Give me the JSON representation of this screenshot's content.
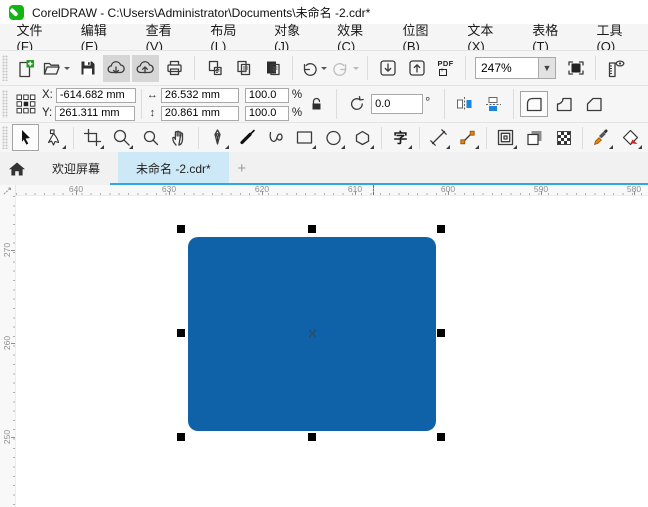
{
  "window": {
    "title": "CorelDRAW - C:\\Users\\Administrator\\Documents\\未命名 -2.cdr*"
  },
  "menu": {
    "items": [
      {
        "label": "文件(F)"
      },
      {
        "label": "编辑(E)"
      },
      {
        "label": "查看(V)"
      },
      {
        "label": "布局(L)"
      },
      {
        "label": "对象(J)"
      },
      {
        "label": "效果(C)"
      },
      {
        "label": "位图(B)"
      },
      {
        "label": "文本(X)"
      },
      {
        "label": "表格(T)"
      },
      {
        "label": "工具(O)"
      }
    ]
  },
  "standard_toolbar": {
    "zoom_level": "247%",
    "pdf_label": "PDF",
    "dropdown_glyph": "▼"
  },
  "property_bar": {
    "x_label": "X:",
    "x_value": "-614.682 mm",
    "y_label": "Y:",
    "y_value": "261.311 mm",
    "width_value": "26.532 mm",
    "height_value": "20.861 mm",
    "width_icon_glyph": "↔",
    "height_icon_glyph": "↕",
    "scale_x_value": "100.0",
    "scale_y_value": "100.0",
    "percent_x": "%",
    "percent_y": "%",
    "rotation_value": "0.0",
    "degree_symbol": "°"
  },
  "toolbox": {
    "text_tool_glyph": "字"
  },
  "tabbar": {
    "welcome_tab": "欢迎屏幕",
    "document_tab": "未命名 -2.cdr*",
    "new_tab_button": "+"
  },
  "rulers": {
    "horizontal": [
      "640",
      "630",
      "620",
      "610",
      "600",
      "590",
      "580"
    ],
    "vertical": [
      "270",
      "260",
      "250"
    ]
  },
  "canvas": {
    "shape_color": "#0F62A7"
  },
  "colors": {
    "accent_blue": "#2FA8DF",
    "active_tab_bg": "#CDE9F7",
    "shape_blue": "#0F62A7",
    "mirror_icon_blue": "#1B87DC",
    "connector_node_orange": "#E8820C"
  }
}
